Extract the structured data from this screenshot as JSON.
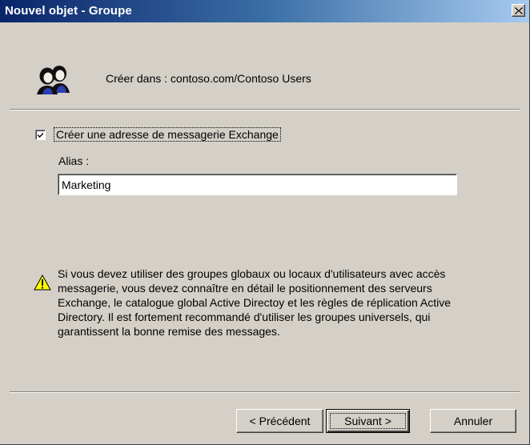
{
  "window": {
    "title": "Nouvel objet - Groupe",
    "close_glyph": "×"
  },
  "header": {
    "icon": "group-users-icon",
    "create_in": "Créer dans : contoso.com/Contoso Users"
  },
  "form": {
    "exchange_checkbox": {
      "label": "Créer une adresse de messagerie Exchange",
      "checked": true
    },
    "alias": {
      "label": "Alias :",
      "value": "Marketing"
    }
  },
  "warning": {
    "icon": "warning-icon",
    "text": "Si vous devez utiliser des groupes globaux ou locaux d'utilisateurs avec accès messagerie, vous devez connaître en détail le positionnement des serveurs Exchange, le catalogue global Active Directoy et les règles de réplication Active Directory. Il est fortement recommandé d'utiliser les groupes universels, qui garantissent la bonne remise des messages."
  },
  "buttons": {
    "previous": "< Précédent",
    "next": "Suivant >",
    "cancel": "Annuler"
  }
}
